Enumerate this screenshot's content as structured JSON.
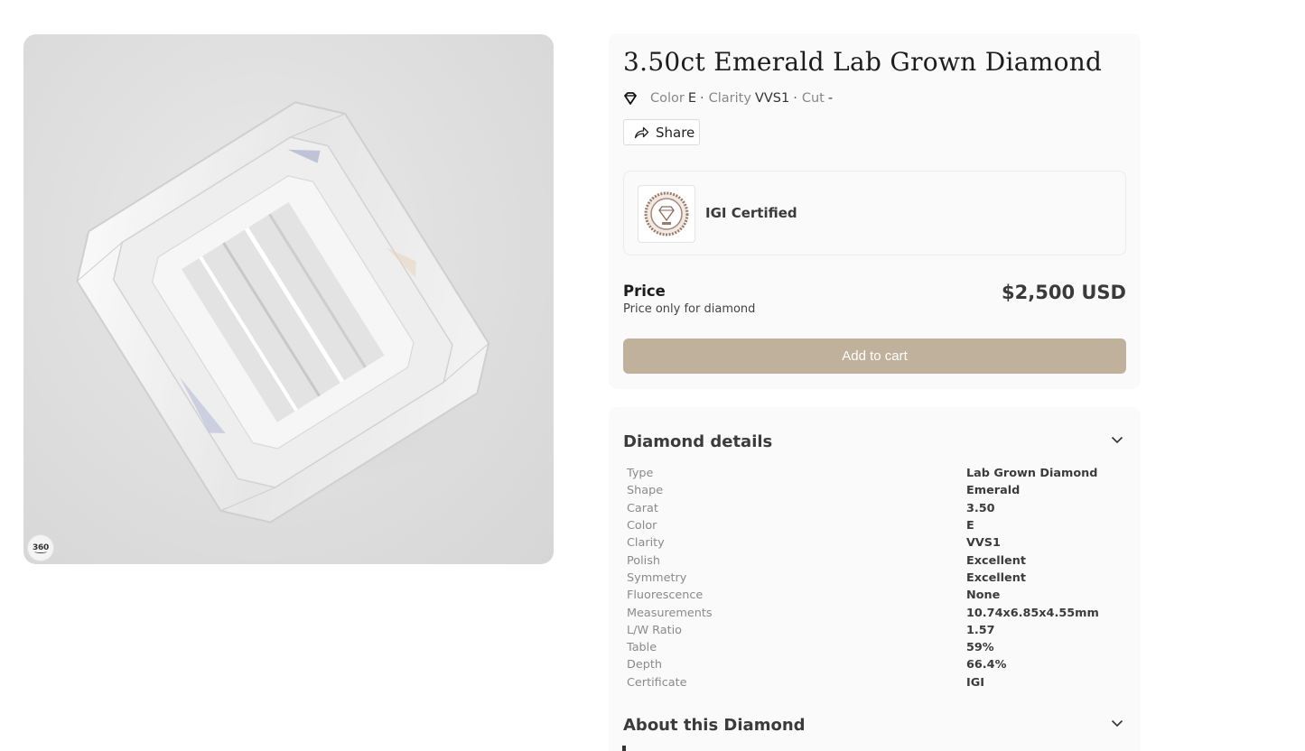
{
  "product": {
    "title": "3.50ct Emerald Lab Grown Diamond",
    "specs": [
      {
        "label": "Color",
        "value": "E"
      },
      {
        "label": "Clarity",
        "value": "VVS1"
      },
      {
        "label": "Cut",
        "value": "-"
      }
    ],
    "separator": "·",
    "share_label": "Share",
    "badge_360": "360"
  },
  "certificate": {
    "label": "IGI Certified",
    "logo_icon": "igi-seal-icon"
  },
  "pricing": {
    "label": "Price",
    "note": "Price only for diamond",
    "value": "$2,500 USD",
    "add_to_cart_label": "Add to cart",
    "button_color": "#bfb19b"
  },
  "details": {
    "title": "Diamond details",
    "rows": [
      {
        "key": "Type",
        "value": "Lab Grown Diamond"
      },
      {
        "key": "Shape",
        "value": "Emerald"
      },
      {
        "key": "Carat",
        "value": "3.50"
      },
      {
        "key": "Color",
        "value": "E"
      },
      {
        "key": "Clarity",
        "value": "VVS1"
      },
      {
        "key": "Polish",
        "value": "Excellent"
      },
      {
        "key": "Symmetry",
        "value": "Excellent"
      },
      {
        "key": "Fluorescence",
        "value": "None"
      },
      {
        "key": "Measurements",
        "value": "10.74x6.85x4.55mm"
      },
      {
        "key": "L/W Ratio",
        "value": "1.57"
      },
      {
        "key": "Table",
        "value": "59%"
      },
      {
        "key": "Depth",
        "value": "66.4%"
      },
      {
        "key": "Certificate",
        "value": "IGI"
      }
    ]
  },
  "about": {
    "title": "About this Diamond"
  }
}
